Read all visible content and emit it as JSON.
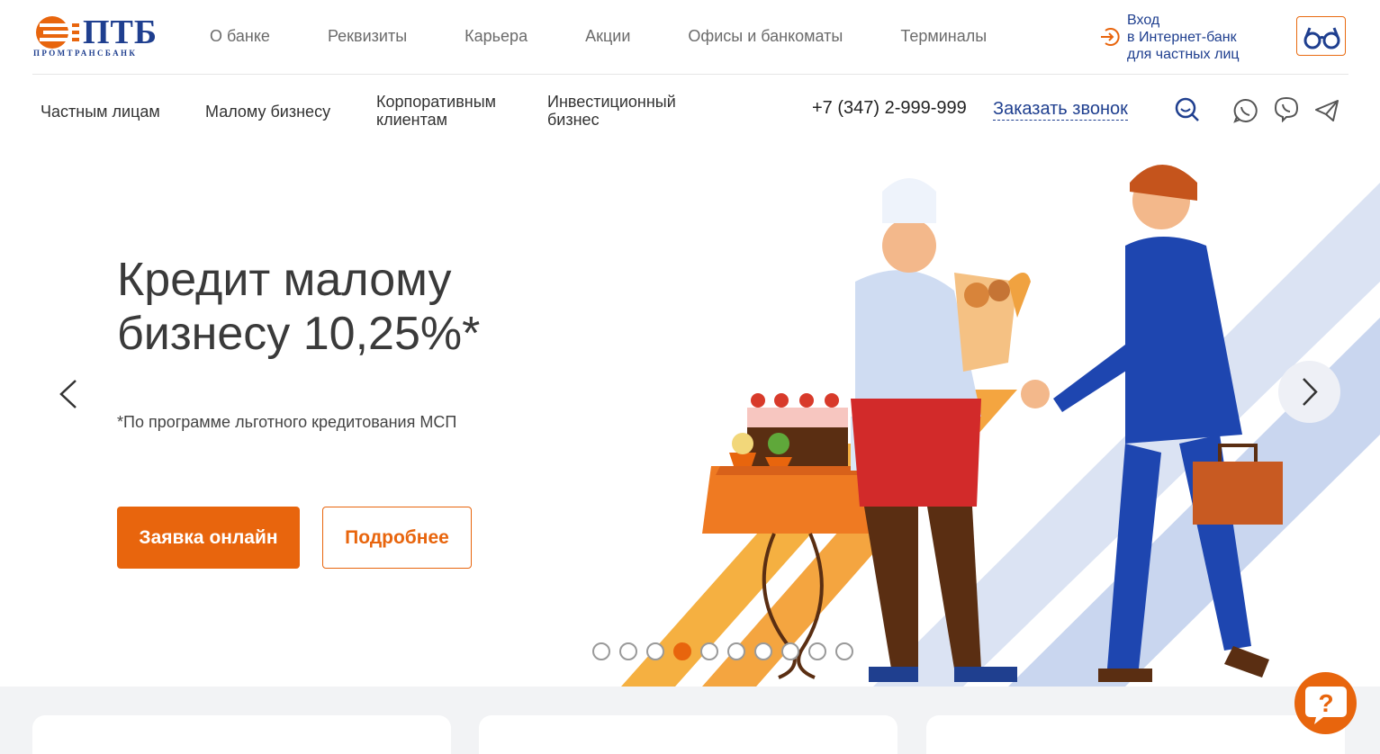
{
  "logo": {
    "name": "ПТБ",
    "subtitle": "ПРОМТРАНСБАНК"
  },
  "top_nav": [
    "О банке",
    "Реквизиты",
    "Карьера",
    "Акции",
    "Офисы и банкоматы",
    "Терминалы"
  ],
  "login": {
    "line1": "Вход",
    "line2": "в Интернет-банк",
    "line3": "для частных лиц"
  },
  "segments": {
    "private": "Частным лицам",
    "small_biz": "Малому бизнесу",
    "corporate_1": "Корпоративным",
    "corporate_2": "клиентам",
    "invest_1": "Инвестиционный",
    "invest_2": "бизнес"
  },
  "contact": {
    "phone": "+7 (347) 2-999-999",
    "callback": "Заказать звонок"
  },
  "hero": {
    "title_1": "Кредит малому",
    "title_2": "бизнесу 10,25%*",
    "note": "*По программе льготного кредитования МСП",
    "primary_btn": "Заявка онлайн",
    "secondary_btn": "Подробнее"
  },
  "slider": {
    "total": 10,
    "active_index": 3
  },
  "help_icon": "?",
  "colors": {
    "accent": "#e8650d",
    "brand": "#1f3f8f"
  }
}
